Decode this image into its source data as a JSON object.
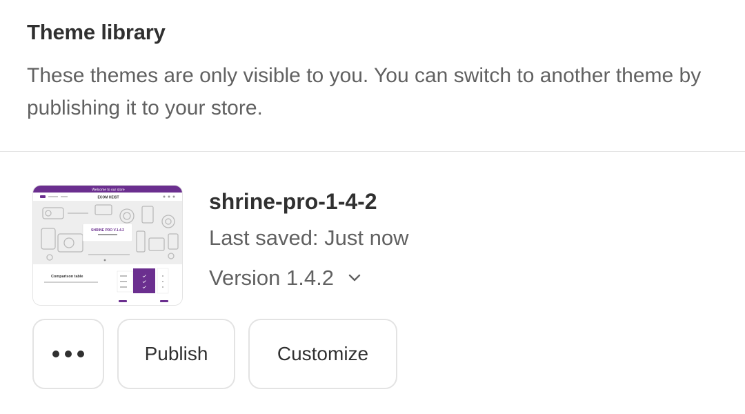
{
  "header": {
    "title": "Theme library",
    "description": "These themes are only visible to you. You can switch to another theme by publishing it to your store."
  },
  "theme": {
    "name": "shrine-pro-1-4-2",
    "last_saved": "Last saved: Just now",
    "version": "Version 1.4.2",
    "thumbnail": {
      "announcement": "Welcome to our store",
      "store_name": "ECOM HEIST",
      "hero_title": "SHRINE PRO V.1.4.2",
      "section_title": "Comparison table"
    }
  },
  "actions": {
    "more_icon": "ellipsis-icon",
    "publish_label": "Publish",
    "customize_label": "Customize"
  },
  "colors": {
    "accent_purple": "#6b2f8f",
    "text_primary": "#303030",
    "text_secondary": "#616161",
    "border": "#e3e3e3"
  }
}
